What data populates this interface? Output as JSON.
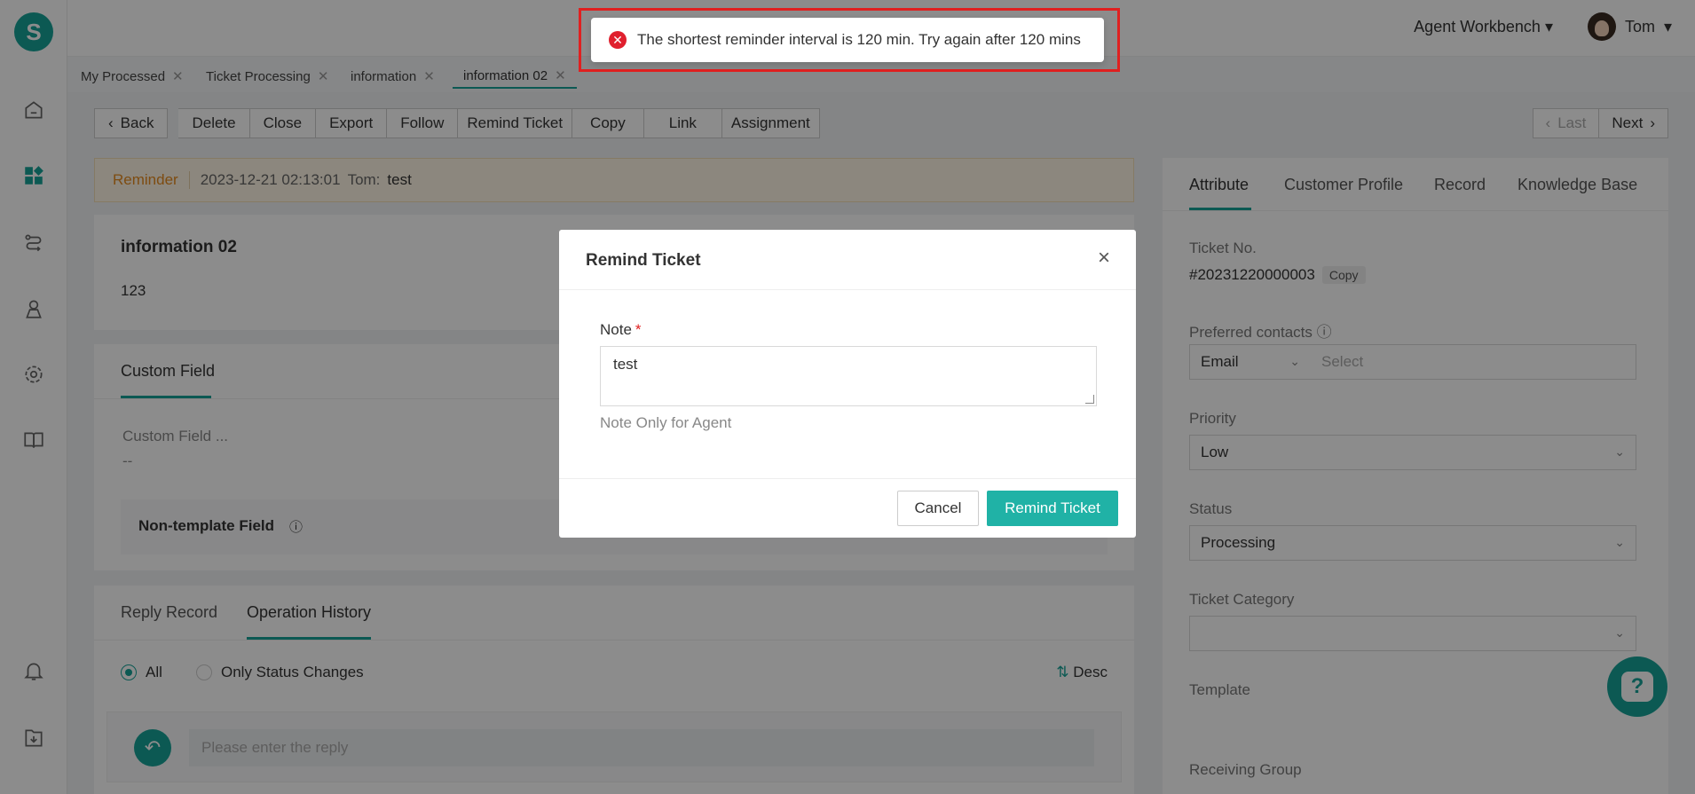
{
  "sidebar": {
    "logo": "S"
  },
  "topbar": {
    "workbench": "Agent Workbench",
    "user_name": "Tom"
  },
  "tabs": [
    {
      "label": "My Processed"
    },
    {
      "label": "Ticket Processing"
    },
    {
      "label": "information"
    },
    {
      "label": "information 02"
    }
  ],
  "toolbar": {
    "back": "Back",
    "buttons": [
      "Delete",
      "Close",
      "Export",
      "Follow",
      "Remind Ticket",
      "Copy",
      "Link",
      "Assignment"
    ],
    "last": "Last",
    "next": "Next"
  },
  "reminder": {
    "label": "Reminder",
    "time": "2023-12-21 02:13:01",
    "user": "Tom:",
    "text": "test"
  },
  "ticket": {
    "title": "information 02",
    "description": "123"
  },
  "custom": {
    "tab": "Custom Field",
    "field_label": "Custom Field ...",
    "field_value": "--",
    "non_template": "Non-template Field"
  },
  "history": {
    "tab_reply": "Reply Record",
    "tab_ops": "Operation History",
    "radio_all": "All",
    "radio_status": "Only Status Changes",
    "sort": "Desc",
    "reply_placeholder": "Please enter the reply"
  },
  "right_panel": {
    "tabs": [
      "Attribute",
      "Customer Profile",
      "Record",
      "Knowledge Base"
    ],
    "ticket_no_label": "Ticket No.",
    "ticket_no": "#20231220000003",
    "copy": "Copy",
    "preferred_label": "Preferred contacts",
    "preferred_type": "Email",
    "preferred_placeholder": "Select",
    "priority_label": "Priority",
    "priority": "Low",
    "status_label": "Status",
    "status": "Processing",
    "category_label": "Ticket Category",
    "template_label": "Template",
    "group_label": "Receiving Group"
  },
  "toast": {
    "message": "The shortest reminder interval is 120 min. Try again after 120 mins"
  },
  "modal": {
    "title": "Remind Ticket",
    "note_label": "Note",
    "required_mark": "*",
    "note_value": "test",
    "hint": "Note Only for Agent",
    "cancel": "Cancel",
    "confirm": "Remind Ticket"
  },
  "colors": {
    "accent": "#17a398",
    "error": "#e0202e",
    "reminder_bg": "#fff6e5"
  }
}
